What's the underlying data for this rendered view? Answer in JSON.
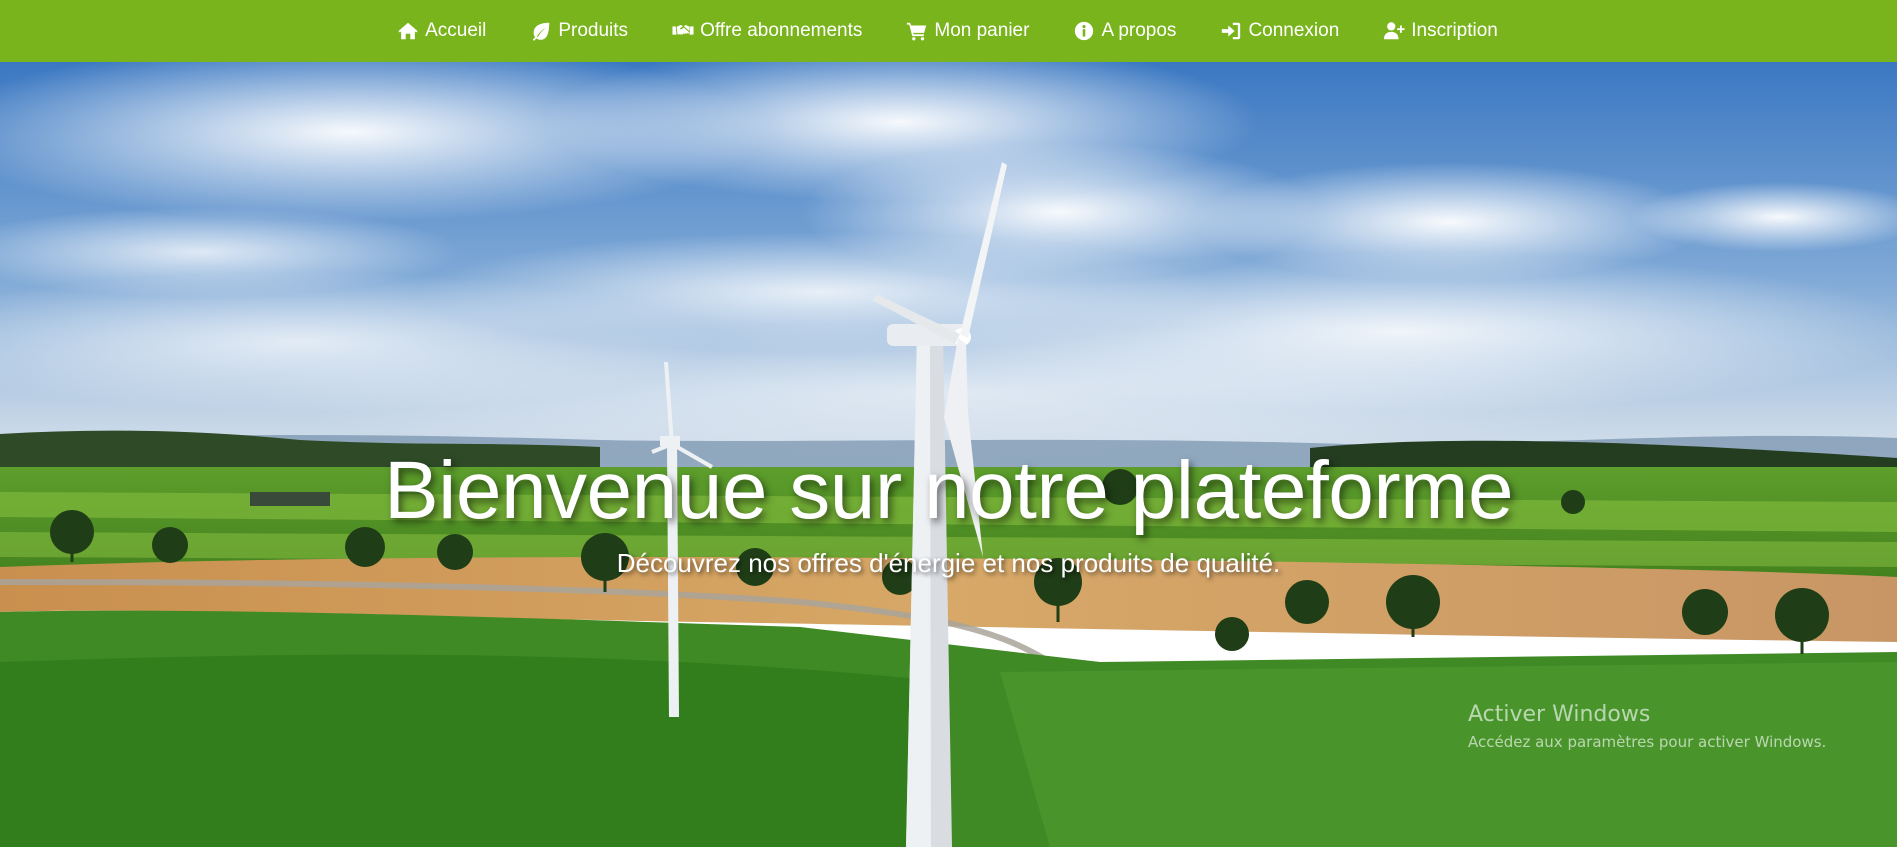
{
  "nav": {
    "items": [
      {
        "label": "Accueil",
        "icon": "home-icon"
      },
      {
        "label": "Produits",
        "icon": "leaf-icon"
      },
      {
        "label": "Offre abonnements",
        "icon": "handshake-icon"
      },
      {
        "label": "Mon panier",
        "icon": "cart-icon"
      },
      {
        "label": "A propos",
        "icon": "info-circle-icon"
      },
      {
        "label": "Connexion",
        "icon": "sign-in-icon"
      },
      {
        "label": "Inscription",
        "icon": "user-plus-icon"
      }
    ],
    "background": "#79b41c",
    "text_color": "#ffffff"
  },
  "hero": {
    "title": "Bienvenue sur notre plateforme",
    "subtitle": "Découvrez nos offres d'énergie et nos produits de qualité.",
    "image": "wind turbines over green and golden fields under a cloudy blue sky"
  },
  "watermark": {
    "title": "Activer Windows",
    "subtitle": "Accédez aux paramètres pour activer Windows."
  }
}
